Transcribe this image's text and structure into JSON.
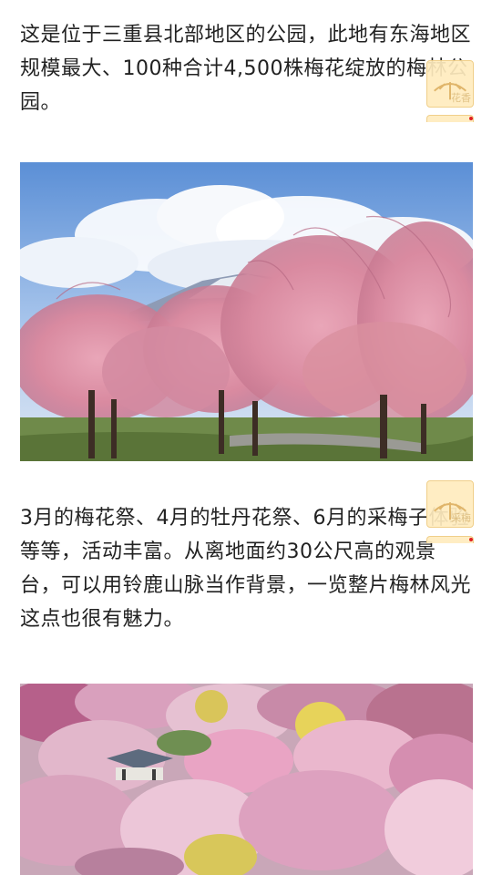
{
  "article": {
    "paragraphs": [
      "这是位于三重县北部地区的公园，此地有东海地区规模最大、100种合计4,500株梅花绽放的梅林公园。",
      "3月的梅花祭、4月的牡丹花祭、6月的采梅子体验等等，活动丰富。从离地面约30公尺高的观景台，可以用铃鹿山脉当作背景，一览整片梅林风光这点也很有魅力。"
    ],
    "images": [
      {
        "name": "weeping-plum-trees-mountain-photo"
      },
      {
        "name": "plum-grove-aerial-photo"
      }
    ]
  },
  "widget": {
    "icon": "plum-blossom-icon",
    "labels": [
      "花香",
      "采梅"
    ]
  },
  "colors": {
    "text": "#222222",
    "widget_bg": "#ffecbe",
    "widget_border": "#f0cf8a",
    "notification_dot": "#e02020"
  }
}
